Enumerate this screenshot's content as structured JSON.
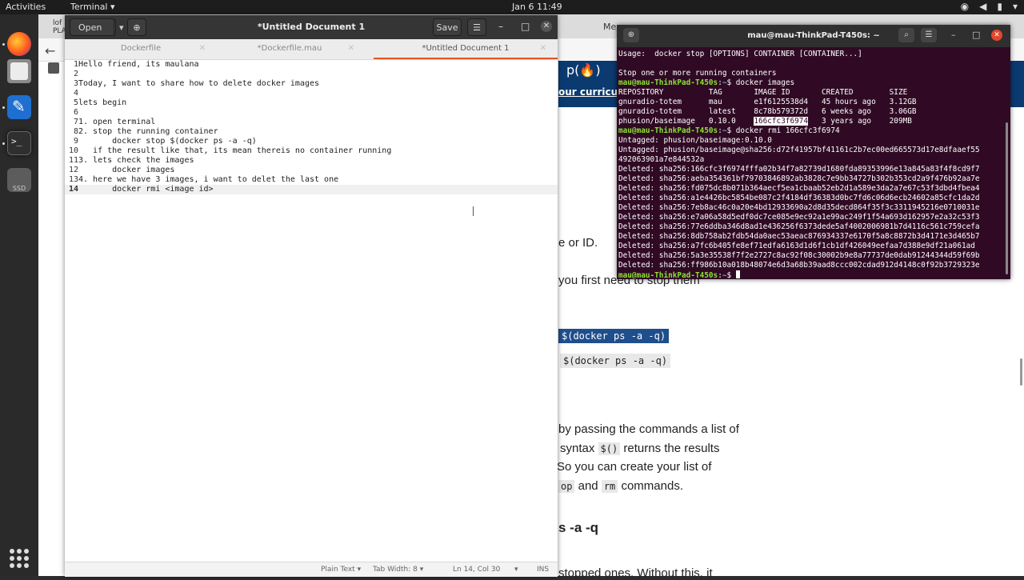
{
  "topbar": {
    "activities": "Activities",
    "app_menu": "Terminal ▾",
    "clock": "Jan 6  11:49",
    "tray_icons": [
      "network-icon",
      "volume-icon",
      "battery-icon",
      "power-menu-icon"
    ]
  },
  "browser": {
    "first_tab_line1": "lof",
    "first_tab_line2": "PLA",
    "other_tab": "Men",
    "hero_link": "our curriculum",
    "article_lines": [
      "e or ID.",
      "you first need to stop them",
      "by passing the commands a list of",
      "syntax",
      "returns the results",
      "So you can create your list of",
      "and",
      "commands.",
      "s -a -q",
      "stopped ones. Without this, it"
    ],
    "code_selected": "$(docker ps -a -q)",
    "code_plain": "$(docker ps -a -q)",
    "code_inline_syntax": "$()",
    "code_inline_stop": "op",
    "code_inline_rm": "rm"
  },
  "gedit": {
    "open_label": "Open",
    "save_label": "Save",
    "window_title": "*Untitled Document 1",
    "tabs": [
      {
        "label": "Dockerfile"
      },
      {
        "label": "*Dockerfile.mau"
      },
      {
        "label": "*Untitled Document 1"
      }
    ],
    "lines": [
      {
        "n": "1",
        "text": "Hello friend, its maulana"
      },
      {
        "n": "2",
        "text": ""
      },
      {
        "n": "3",
        "text": "Today, I want to share how to delete docker images"
      },
      {
        "n": "4",
        "text": ""
      },
      {
        "n": "5",
        "text": "lets begin"
      },
      {
        "n": "6",
        "text": ""
      },
      {
        "n": "7",
        "text": "1. open terminal"
      },
      {
        "n": "8",
        "text": "2. stop the running container"
      },
      {
        "n": "9",
        "text": "       docker stop $(docker ps -a -q)"
      },
      {
        "n": "10",
        "text": "   if the result like that, its mean thereis no container running"
      },
      {
        "n": "11",
        "text": "3. lets check the images"
      },
      {
        "n": "12",
        "text": "       docker images"
      },
      {
        "n": "13",
        "text": "4. here we have 3 images, i want to delet the last one"
      },
      {
        "n": "14",
        "text": "       docker rmi <image id>"
      }
    ],
    "status": {
      "language": "Plain Text ▾",
      "tab_width": "Tab Width: 8 ▾",
      "position": "Ln 14, Col 30",
      "mode": "INS"
    }
  },
  "terminal": {
    "title": "mau@mau-ThinkPad-T450s: ~",
    "lines": [
      {
        "kind": "out",
        "text": "Usage:  docker stop [OPTIONS] CONTAINER [CONTAINER...]"
      },
      {
        "kind": "out",
        "text": ""
      },
      {
        "kind": "out",
        "text": "Stop one or more running containers"
      },
      {
        "kind": "cmd",
        "prompt": "mau@mau-ThinkPad-T450s",
        "path": "~",
        "text": "$ docker images"
      },
      {
        "kind": "out",
        "text": "REPOSITORY          TAG       IMAGE ID       CREATED        SIZE"
      },
      {
        "kind": "out",
        "text": "gnuradio-totem      mau       e1f6125538d4   45 hours ago   3.12GB"
      },
      {
        "kind": "out",
        "text": "gnuradio-totem      latest    8c78b579372d   6 weeks ago    3.06GB"
      },
      {
        "kind": "hl",
        "pre": "phusion/baseimage   0.10.0    ",
        "hl": "166cfc3f6974",
        "post": "   3 years ago    209MB"
      },
      {
        "kind": "cmd",
        "prompt": "mau@mau-ThinkPad-T450s",
        "path": "~",
        "text": "$ docker rmi 166cfc3f6974"
      },
      {
        "kind": "out",
        "text": "Untagged: phusion/baseimage:0.10.0"
      },
      {
        "kind": "out",
        "text": "Untagged: phusion/baseimage@sha256:d72f41957bf41161c2b7ec00ed665573d17e8dfaaef55"
      },
      {
        "kind": "out",
        "text": "492063901a7e844532a"
      },
      {
        "kind": "out",
        "text": "Deleted: sha256:166cfc3f6974fffa02b34f7a82739d1680fda89353996e13a845a83f4f8cd9f7"
      },
      {
        "kind": "out",
        "text": "Deleted: sha256:aeba354361bf79703846892ab3828c7e9bb34727b302b353cd2a9f476b92aa7e"
      },
      {
        "kind": "out",
        "text": "Deleted: sha256:fd075dc8b071b364aecf5ea1cbaab52eb2d1a589e3da2a7e67c53f3dbd4fbea4"
      },
      {
        "kind": "out",
        "text": "Deleted: sha256:a1e4426bc5854be087c2f4184df36383d0bc7fd6c06d6ecb24602a85cfc1da2d"
      },
      {
        "kind": "out",
        "text": "Deleted: sha256:7eb8ac46c0a20e4bd12933690a2d8d35decd864f35f3c3311945216e0710031e"
      },
      {
        "kind": "out",
        "text": "Deleted: sha256:e7a06a58d5edf0dc7ce085e9ec92a1e99ac249f1f54a693d162957e2a32c53f3"
      },
      {
        "kind": "out",
        "text": "Deleted: sha256:77e6ddba346d8ad1e436256f6373dede5af4002006981b7d4116c561c759cefa"
      },
      {
        "kind": "out",
        "text": "Deleted: sha256:8db758ab2fdb54da0aec53aeac876934337e6170f5a8c8872b3d4171e3d465b7"
      },
      {
        "kind": "out",
        "text": "Deleted: sha256:a7fc6b405fe8ef71edfa6163d1d6f1cb1df426049eefaa7d388e9df21a061ad"
      },
      {
        "kind": "out",
        "text": "Deleted: sha256:5a3e35538f7f2e2727c8ac92f08c30002b9e8a77737de0dab91244344d59f69b"
      },
      {
        "kind": "out",
        "text": "Deleted: sha256:ff986b10a018b48074e6d3a68b39aad8ccc002cdad912d4148c0f92b3729323e"
      },
      {
        "kind": "final",
        "prompt": "mau@mau-ThinkPad-T450s",
        "path": "~",
        "text": "$ "
      }
    ]
  },
  "colors": {
    "terminal_bg": "#300a24",
    "prompt_green": "#8ae234",
    "path_blue": "#729fcf",
    "accent_orange": "#e95420"
  }
}
